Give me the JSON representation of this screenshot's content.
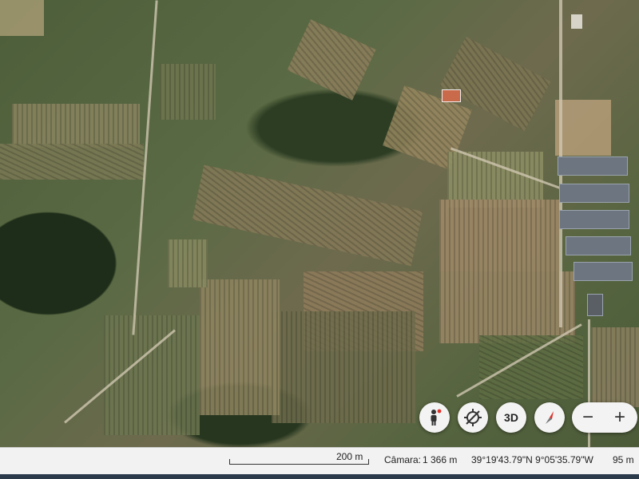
{
  "map": {
    "scale_label": "200 m",
    "camera_label": "Câmara:",
    "camera_value": "1 366 m",
    "coordinates": "39°19'43.79\"N 9°05'35.79\"W",
    "elevation": "95 m"
  },
  "controls": {
    "three_d_label": "3D",
    "zoom_out_label": "−",
    "zoom_in_label": "+"
  },
  "icons": [
    "pegman-icon",
    "location-icon",
    "compass-icon"
  ],
  "colors": {
    "control_bg": "#f3f3f3",
    "compass_red": "#e0312a",
    "statusbar_bg": "#f2f2f2"
  }
}
